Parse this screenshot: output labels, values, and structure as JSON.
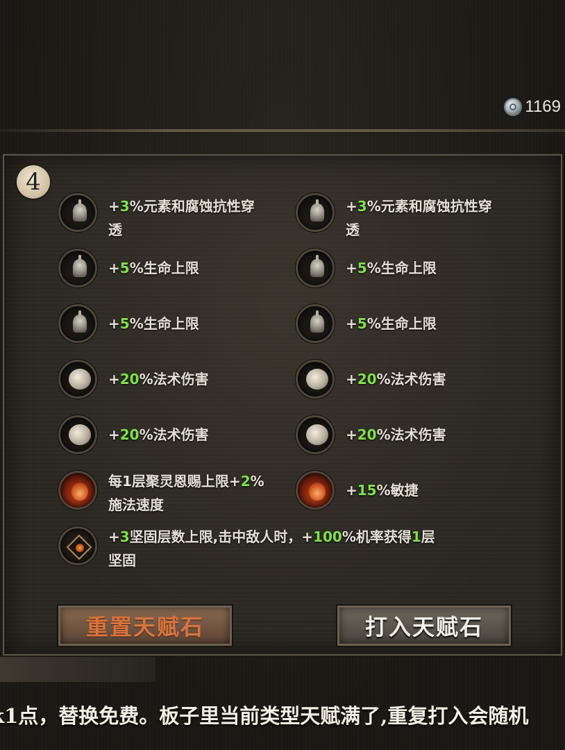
{
  "currency": {
    "icon": "silver-coin-icon",
    "amount": "1169"
  },
  "panel": {
    "level": "4",
    "talents": [
      {
        "icon": "helm-icon",
        "prefix": "+",
        "num": "3",
        "suffix": "%元素和腐蚀抗性穿",
        "line2": "透"
      },
      {
        "icon": "helm-icon",
        "prefix": "+",
        "num": "3",
        "suffix": "%元素和腐蚀抗性穿",
        "line2": "透"
      },
      {
        "icon": "helm-icon",
        "prefix": "+",
        "num": "5",
        "suffix": "%生命上限"
      },
      {
        "icon": "helm-icon",
        "prefix": "+",
        "num": "5",
        "suffix": "%生命上限"
      },
      {
        "icon": "helm-icon",
        "prefix": "+",
        "num": "5",
        "suffix": "%生命上限"
      },
      {
        "icon": "helm-icon",
        "prefix": "+",
        "num": "5",
        "suffix": "%生命上限"
      },
      {
        "icon": "orb-icon",
        "prefix": "+",
        "num": "20",
        "suffix": "%法术伤害"
      },
      {
        "icon": "orb-icon",
        "prefix": "+",
        "num": "20",
        "suffix": "%法术伤害"
      },
      {
        "icon": "orb-icon",
        "prefix": "+",
        "num": "20",
        "suffix": "%法术伤害"
      },
      {
        "icon": "orb-icon",
        "prefix": "+",
        "num": "20",
        "suffix": "%法术伤害"
      },
      {
        "icon": "fire-icon",
        "prefix": "每1层聚灵恩赐上限+",
        "num": "2",
        "suffix": "%",
        "line2": "施法速度"
      },
      {
        "icon": "fire-icon",
        "prefix": "+",
        "num": "15",
        "suffix": "%敏捷"
      },
      {
        "icon": "shield-icon",
        "prefix": "+",
        "num": "3",
        "suffix": "坚固层数上限,击中敌人时，",
        "mid": "+",
        "num2": "100",
        "suffix2": "%机率获得",
        "num3": "1",
        "suffix3": "层",
        "line2": "坚固"
      }
    ],
    "buttons": {
      "reset": "重置天赋石",
      "insert": "打入天赋石"
    }
  },
  "caption": "k1点，替换免费。板子里当前类型天赋满了,重复打入会随机"
}
